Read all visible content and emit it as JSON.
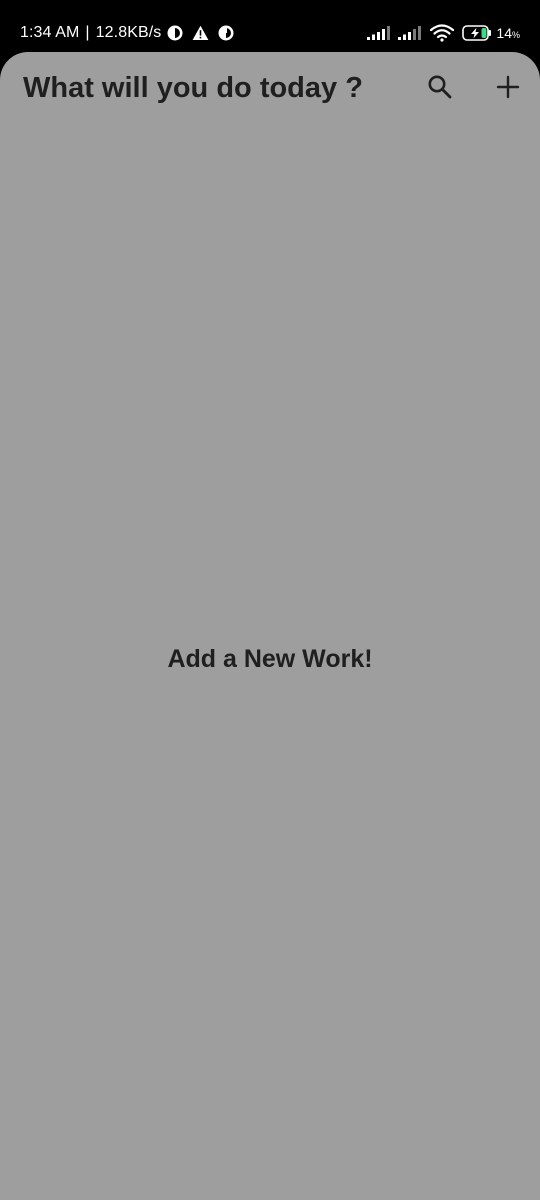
{
  "status_bar": {
    "time": "1:34 AM",
    "separator": "|",
    "net_speed": "12.8KB/s",
    "battery_level": "14",
    "battery_unit": "%",
    "icons": [
      "data-saver-icon",
      "warning-icon",
      "data-saver-icon",
      "signal-1-icon",
      "signal-2-icon",
      "wifi-icon",
      "battery-charging-icon"
    ]
  },
  "header": {
    "title": "What will you do today ?",
    "search_icon": "search-icon",
    "add_icon": "plus-icon"
  },
  "main": {
    "empty_message": "Add a New Work!"
  },
  "colors": {
    "background": "#9e9e9e",
    "status_bar": "#000000",
    "text": "#1f1f1f",
    "battery_charge": "#3ddc84"
  }
}
